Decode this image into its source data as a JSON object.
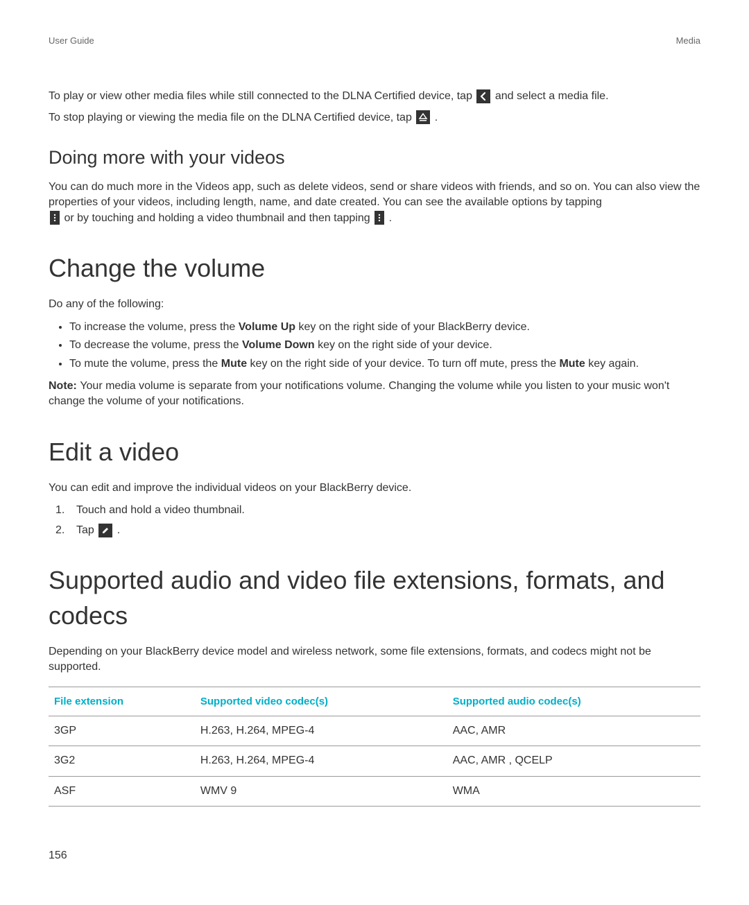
{
  "header": {
    "left": "User Guide",
    "right": "Media"
  },
  "intro": {
    "p1a": "To play or view other media files while still connected to the DLNA Certified device, tap ",
    "p1b": " and select a media file.",
    "p2a": "To stop playing or viewing the media file on the DLNA Certified device, tap ",
    "p2b": "."
  },
  "doing_more": {
    "heading": "Doing more with your videos",
    "p1": "You can do much more in the Videos app, such as delete videos, send or share videos with friends, and so on. You can also view the properties of your videos, including length, name, and date created. You can see the available options by tapping ",
    "p2a": " or by touching and holding a video thumbnail and then tapping ",
    "p2b": "."
  },
  "volume": {
    "heading": "Change the volume",
    "lead": "Do any of the following:",
    "b1a": "To increase the volume, press the ",
    "b1key": "Volume Up",
    "b1b": " key on the right side of your BlackBerry device.",
    "b2a": "To decrease the volume, press the ",
    "b2key": "Volume Down",
    "b2b": " key on the right side of your device.",
    "b3a": "To mute the volume, press the ",
    "b3key1": "Mute",
    "b3b": " key on the right side of your device. To turn off mute, press the ",
    "b3key2": "Mute",
    "b3c": " key again.",
    "note_label": "Note: ",
    "note": "Your media volume is separate from your notifications volume. Changing the volume while you listen to your music won't change the volume of your notifications."
  },
  "edit": {
    "heading": "Edit a video",
    "lead": "You can edit and improve the individual videos on your BlackBerry device.",
    "s1n": "1.",
    "s1": "Touch and hold a video thumbnail.",
    "s2n": "2.",
    "s2a": "Tap ",
    "s2b": "."
  },
  "formats": {
    "heading": "Supported audio and video file extensions, formats, and codecs",
    "lead": "Depending on your BlackBerry device model and wireless network, some file extensions, formats, and codecs might not be supported.",
    "cols": [
      "File extension",
      "Supported video codec(s)",
      "Supported audio codec(s)"
    ],
    "rows": [
      [
        "3GP",
        "H.263, H.264, MPEG-4",
        "AAC, AMR"
      ],
      [
        "3G2",
        "H.263, H.264, MPEG-4",
        "AAC, AMR , QCELP"
      ],
      [
        "ASF",
        "WMV 9",
        "WMA"
      ]
    ]
  },
  "page_num": "156"
}
